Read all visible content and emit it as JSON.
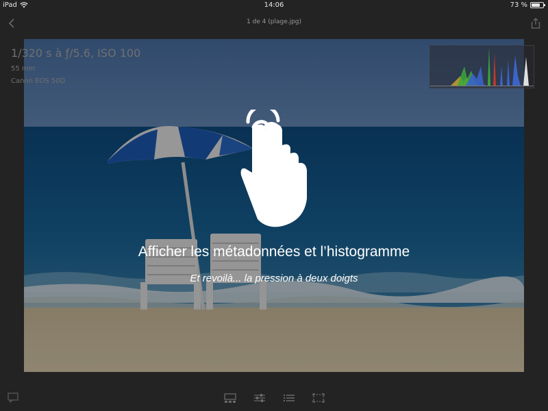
{
  "status_bar": {
    "device": "iPad",
    "time": "14:06",
    "battery_text": "73 %",
    "battery_level": 0.73
  },
  "navbar": {
    "title": "1 de 4 (plage.jpg)",
    "back_icon": "chevron-left-icon",
    "share_icon": "share-icon"
  },
  "metadata": {
    "exposure": "1/320 s à ƒ/5.6, ISO 100",
    "focal_length": "55 mm",
    "camera": "Canon EOS 50D"
  },
  "overlay": {
    "gesture_icon": "two-finger-tap-icon",
    "title": "Afficher les métadonnées et l’histogramme",
    "subtitle": "Et revoilà... la pression à deux doigts"
  },
  "toolbar": {
    "items": [
      "filmstrip-icon",
      "adjust-sliders-icon",
      "list-icon",
      "crop-icon"
    ],
    "comment_icon": "comment-icon"
  },
  "colors": {
    "background": "#232323",
    "histogram_red": "#c0392b",
    "histogram_green": "#3aa83a",
    "histogram_blue": "#3a64c8"
  }
}
